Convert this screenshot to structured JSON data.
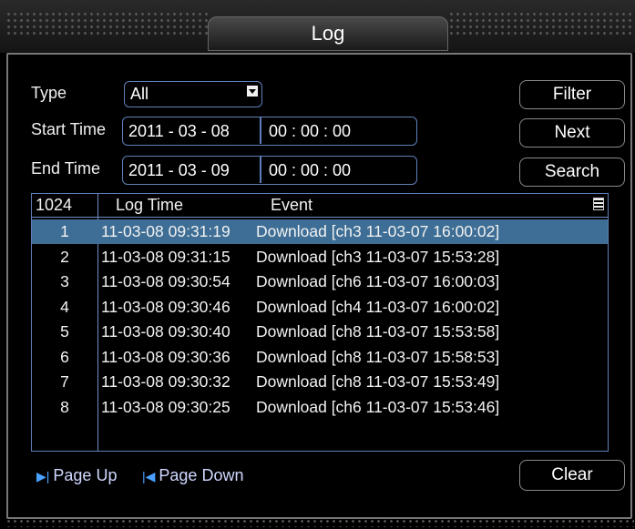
{
  "window": {
    "title": "Log"
  },
  "filters": {
    "type_label": "Type",
    "type_value": "All",
    "start_label": "Start Time",
    "start_date": "2011 - 03 - 08",
    "start_time": "00 : 00 : 00",
    "end_label": "End Time",
    "end_date": "2011 - 03 - 09",
    "end_time": "00 : 00 : 00"
  },
  "buttons": {
    "filter": "Filter",
    "next": "Next",
    "search": "Search",
    "clear": "Clear"
  },
  "table": {
    "count": "1024",
    "col_time": "Log Time",
    "col_event": "Event",
    "rows": [
      {
        "no": "1",
        "time": "11-03-08 09:31:19",
        "event": "Download [ch3 11-03-07 16:00:02]"
      },
      {
        "no": "2",
        "time": "11-03-08 09:31:15",
        "event": "Download [ch3 11-03-07 15:53:28]"
      },
      {
        "no": "3",
        "time": "11-03-08 09:30:54",
        "event": "Download [ch6 11-03-07 16:00:03]"
      },
      {
        "no": "4",
        "time": "11-03-08 09:30:46",
        "event": "Download [ch4 11-03-07 16:00:02]"
      },
      {
        "no": "5",
        "time": "11-03-08 09:30:40",
        "event": "Download [ch8 11-03-07 15:53:58]"
      },
      {
        "no": "6",
        "time": "11-03-08 09:30:36",
        "event": "Download [ch8 11-03-07 15:58:53]"
      },
      {
        "no": "7",
        "time": "11-03-08 09:30:32",
        "event": "Download [ch8 11-03-07 15:53:49]"
      },
      {
        "no": "8",
        "time": "11-03-08 09:30:25",
        "event": "Download [ch6 11-03-07 15:53:46]"
      }
    ]
  },
  "pagination": {
    "page_up": "Page Up",
    "page_down": "Page Down"
  },
  "icons": {
    "page_up": "next-page-icon",
    "page_down": "prev-page-icon",
    "scroll": "list-scroll-icon",
    "dropdown": "chevron-down-icon"
  },
  "colors": {
    "selection": "#3e6e95",
    "field_border": "#5f7fb8"
  }
}
